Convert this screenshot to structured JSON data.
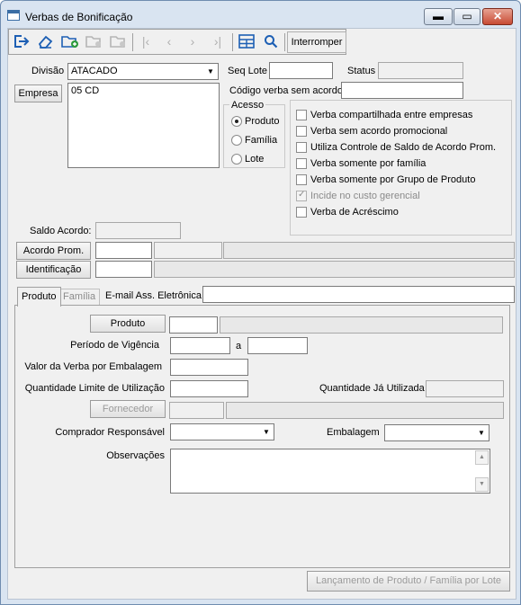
{
  "window": {
    "title": "Verbas de Bonificação"
  },
  "toolbar": {
    "interromper": "Interromper"
  },
  "header": {
    "divisao_label": "Divisão",
    "divisao_value": "ATACADO",
    "seq_lote_label": "Seq Lote",
    "seq_lote_value": "",
    "status_label": "Status",
    "status_value": "",
    "empresa_button": "Empresa",
    "empresa_value": "05 CD",
    "codigo_label": "Código verba sem acordo",
    "codigo_value": ""
  },
  "acesso": {
    "title": "Acesso",
    "options": [
      "Produto",
      "Família",
      "Lote"
    ],
    "selected": "Produto"
  },
  "checkboxes": [
    {
      "label": "Verba compartilhada entre empresas",
      "checked": false,
      "enabled": true
    },
    {
      "label": "Verba sem acordo promocional",
      "checked": false,
      "enabled": true
    },
    {
      "label": "Utiliza Controle de Saldo de Acordo Prom.",
      "checked": false,
      "enabled": true
    },
    {
      "label": "Verba somente por família",
      "checked": false,
      "enabled": true
    },
    {
      "label": "Verba somente por Grupo de Produto",
      "checked": false,
      "enabled": true
    },
    {
      "label": "Incide no custo gerencial",
      "checked": true,
      "enabled": false
    },
    {
      "label": "Verba de Acréscimo",
      "checked": false,
      "enabled": true
    }
  ],
  "acordo": {
    "saldo_label": "Saldo Acordo:",
    "acordo_prom_button": "Acordo Prom.",
    "identificacao_button": "Identificação"
  },
  "tabs": [
    "Produto",
    "Família",
    "E-mail Ass. Eletrônica"
  ],
  "form": {
    "produto_button": "Produto",
    "periodo_label": "Período de Vigência",
    "periodo_sep": "a",
    "valor_label": "Valor da Verba por Embalagem",
    "qtd_limite_label": "Quantidade Limite de Utilização",
    "qtd_utilizada_label": "Quantidade Já Utilizada",
    "fornecedor_button": "Fornecedor",
    "comprador_label": "Comprador Responsável",
    "embalagem_label": "Embalagem",
    "observacoes_label": "Observações"
  },
  "footer": {
    "lancamento_button": "Lançamento de Produto / Família por Lote"
  }
}
